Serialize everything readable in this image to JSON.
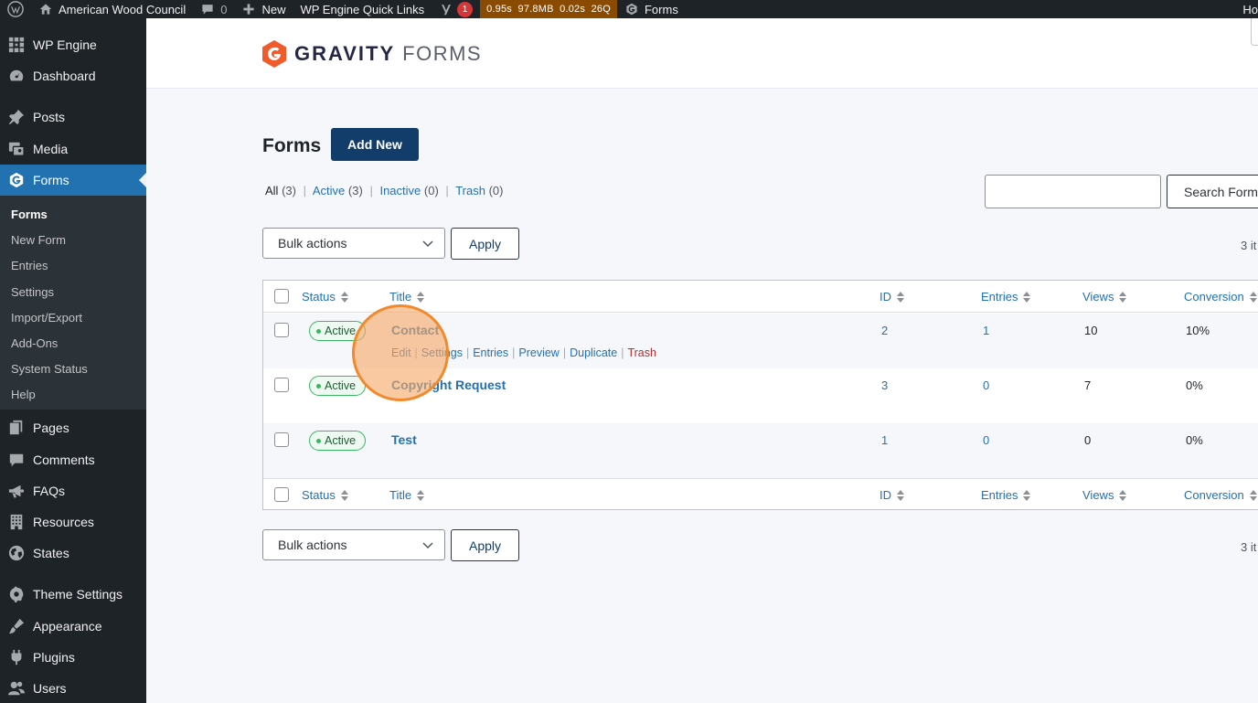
{
  "adminbar": {
    "site_name": "American Wood Council",
    "comments_count": "0",
    "new_label": "New",
    "quick_links": "WP Engine Quick Links",
    "yoast_badge": "1",
    "perf_time": "0.95s",
    "perf_mem": "97.8MB",
    "perf_query_time": "0.02s",
    "perf_queries": "26Q",
    "forms_label": "Forms",
    "howdy": "Ho"
  },
  "sidebar": {
    "items": [
      {
        "label": "WP Engine",
        "icon": "wp-engine-icon"
      },
      {
        "label": "Dashboard",
        "icon": "dashboard-icon"
      },
      {
        "label": "Posts",
        "icon": "pin-icon"
      },
      {
        "label": "Media",
        "icon": "media-icon"
      },
      {
        "label": "Forms",
        "icon": "gravity-forms-icon"
      },
      {
        "label": "Pages",
        "icon": "pages-icon"
      },
      {
        "label": "Comments",
        "icon": "comments-icon"
      },
      {
        "label": "FAQs",
        "icon": "megaphone-icon"
      },
      {
        "label": "Resources",
        "icon": "building-icon"
      },
      {
        "label": "States",
        "icon": "globe-icon"
      },
      {
        "label": "Theme Settings",
        "icon": "gear-icon"
      },
      {
        "label": "Appearance",
        "icon": "brush-icon"
      },
      {
        "label": "Plugins",
        "icon": "plugin-icon"
      },
      {
        "label": "Users",
        "icon": "users-icon"
      }
    ],
    "submenu": [
      "Forms",
      "New Form",
      "Entries",
      "Settings",
      "Import/Export",
      "Add-Ons",
      "System Status",
      "Help"
    ]
  },
  "header": {
    "logo_bold": "GRAVITY",
    "logo_light": "FORMS"
  },
  "page": {
    "title": "Forms",
    "add_new": "Add New",
    "views": {
      "all": "All",
      "all_count": "(3)",
      "active": "Active",
      "active_count": "(3)",
      "inactive": "Inactive",
      "inactive_count": "(0)",
      "trash": "Trash",
      "trash_count": "(0)"
    },
    "search_button": "Search Forms",
    "search_placeholder": "",
    "bulk_actions": "Bulk actions",
    "apply": "Apply",
    "items_count": "3 it"
  },
  "table": {
    "columns": {
      "status": "Status",
      "title": "Title",
      "id": "ID",
      "entries": "Entries",
      "views": "Views",
      "conversion": "Conversion"
    },
    "rows": [
      {
        "status": "Active",
        "title": "Contact",
        "id": "2",
        "entries": "1",
        "views": "10",
        "conversion": "10%"
      },
      {
        "status": "Active",
        "title": "Copyright Request",
        "id": "3",
        "entries": "0",
        "views": "7",
        "conversion": "0%"
      },
      {
        "status": "Active",
        "title": "Test",
        "id": "1",
        "entries": "0",
        "views": "0",
        "conversion": "0%"
      }
    ],
    "row_actions": {
      "edit": "Edit",
      "settings": "Settings",
      "entries": "Entries",
      "preview": "Preview",
      "duplicate": "Duplicate",
      "trash": "Trash"
    }
  },
  "colors": {
    "admin_bar": "#1d2327",
    "accent": "#2271b1",
    "primary_button": "#123d6b",
    "active_status": "#3ab662",
    "trash_link": "#b32d2e",
    "cursor_highlight": "#f08a2c"
  }
}
